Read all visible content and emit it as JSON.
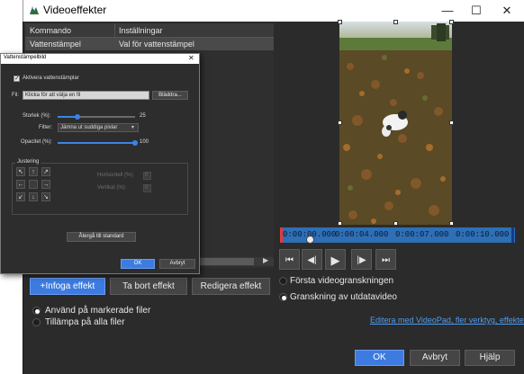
{
  "window": {
    "title": "Videoeffekter",
    "controls": {
      "minimize": "—",
      "maximize": "☐",
      "close": "✕"
    }
  },
  "table": {
    "headers": [
      "Kommando",
      "Inställningar"
    ],
    "rows": [
      {
        "command": "Vattenstämpel",
        "setting": "Val för vattenstämpel"
      }
    ]
  },
  "effect_buttons": {
    "insert": "+Infoga effekt",
    "remove": "Ta bort effekt",
    "edit": "Redigera effekt"
  },
  "apply_options": {
    "marked": "Använd på markerade filer",
    "all": "Tillämpa på alla filer",
    "selected": "marked"
  },
  "preview_options": {
    "first": "Första videogranskningen",
    "output": "Granskning av utdatavideo",
    "selected": "output"
  },
  "timeline": {
    "times": [
      "0:00:00.000",
      "0:00:04.000",
      "0:00:07.000",
      "0:00:10.000"
    ],
    "playhead_fraction": 0.12
  },
  "transport": {
    "to_start": "⏮",
    "prev_frame": "◀|",
    "play": "▶",
    "next_frame": "|▶",
    "to_end": "⏭"
  },
  "link_text": "Editera med VideoPad, fler verktyg, effekter",
  "footer": {
    "ok": "OK",
    "cancel": "Avbryt",
    "help": "Hjälp"
  },
  "dialog": {
    "title": "Vattenstämpelbild",
    "close": "✕",
    "activate_label": "Aktivera vattenstämplar",
    "activate_checked": true,
    "file_label": "Fil:",
    "file_value": "Klicka för att välja en fil",
    "browse_label": "Bläddra...",
    "size_label": "Storlek (%):",
    "size_value": "25",
    "size_fraction": 0.25,
    "filter_label": "Filter:",
    "filter_value": "Jämna ut suddiga pixlar",
    "opacity_label": "Opacitet (%):",
    "opacity_value": "100",
    "opacity_fraction": 1.0,
    "adjustment_label": "Justering",
    "arrows": [
      "↖",
      "↑",
      "↗",
      "←",
      "",
      "→",
      "↙",
      "↓",
      "↘"
    ],
    "horizontal_label": "Horisontell (%):",
    "horizontal_value": "0",
    "vertical_label": "Vertikal (%):",
    "vertical_value": "0",
    "reset_label": "Återgå till standard",
    "ok": "OK",
    "cancel": "Avbryt"
  }
}
